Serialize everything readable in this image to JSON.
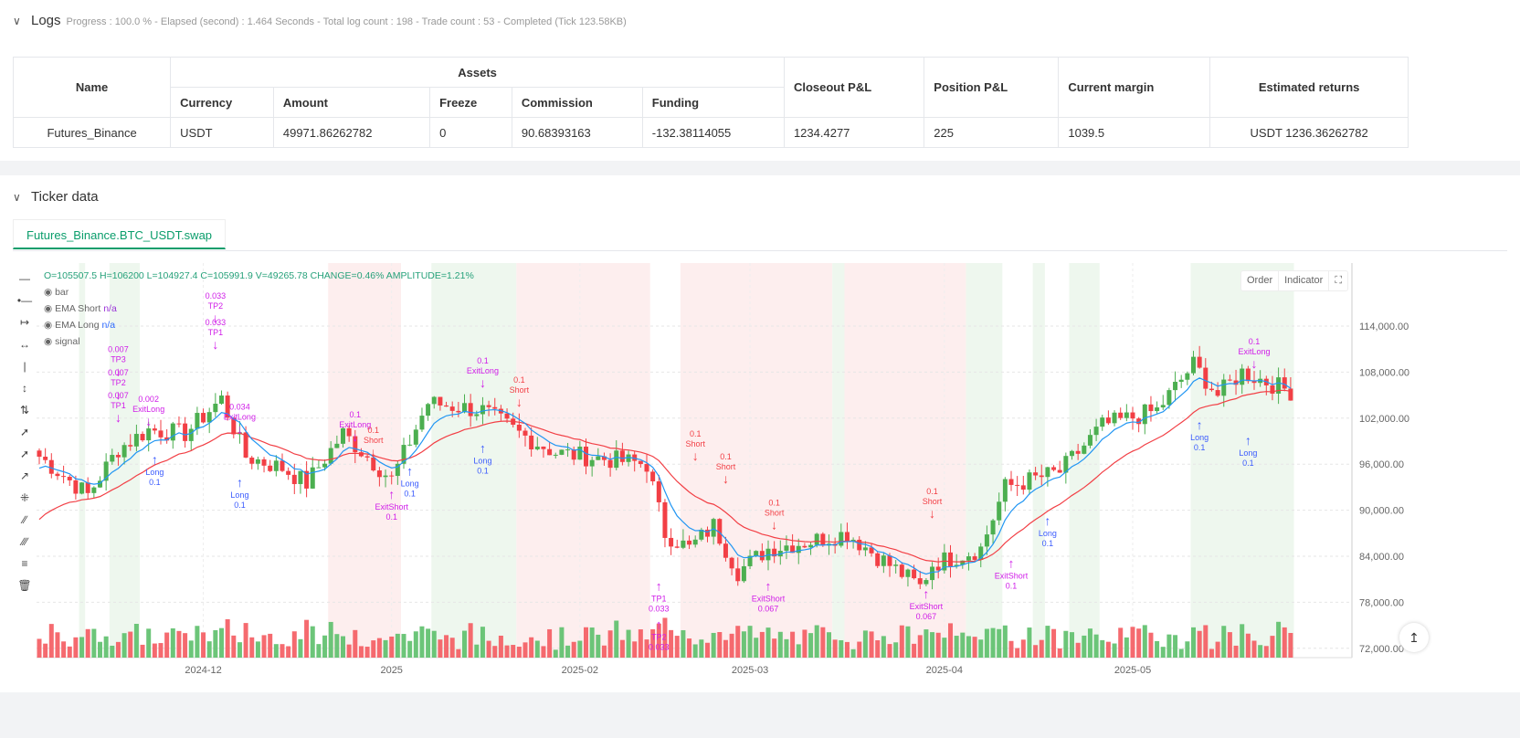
{
  "logs": {
    "title": "Logs",
    "summary": "Progress : 100.0 % - Elapsed (second) : 1.464  Seconds - Total log count : 198 - Trade count : 53 - Completed (Tick 123.58KB)"
  },
  "table": {
    "group_headers": {
      "name": "Name",
      "assets": "Assets",
      "closeout": "Closeout P&L",
      "position": "Position P&L",
      "margin": "Current margin",
      "returns": "Estimated returns"
    },
    "sub_headers": [
      "Currency",
      "Amount",
      "Freeze",
      "Commission",
      "Funding"
    ],
    "row": {
      "name": "Futures_Binance",
      "currency": "USDT",
      "amount": "49971.86262782",
      "freeze": "0",
      "commission": "90.68393163",
      "funding": "-132.38114055",
      "closeout": "1234.4277",
      "position": "225",
      "margin": "1039.5",
      "returns": "USDT 1236.36262782"
    }
  },
  "ticker": {
    "title": "Ticker data",
    "tab": "Futures_Binance.BTC_USDT.swap"
  },
  "chart_buttons": {
    "order": "Order",
    "indicator": "Indicator"
  },
  "legend": {
    "ohlc": "O=105507.5 H=106200 L=104927.4 C=105991.9 V=49265.78 CHANGE=0.46% AMPLITUDE=1.21%",
    "items": [
      "bar",
      "EMA Short",
      "EMA Long",
      "signal"
    ],
    "na": "n/a"
  },
  "colors": {
    "up": "#4caf50",
    "down": "#f23f45",
    "ema_short": "#2196f3",
    "ema_long": "#f23f45",
    "green_bg": "#eef7ee",
    "red_bg": "#fdeeee",
    "signal": "#d01ee8",
    "long": "#3b5bfd"
  },
  "chart_data": {
    "type": "candlestick",
    "ylim": [
      70000,
      117000
    ],
    "y_ticks": [
      72000,
      78000,
      84000,
      90000,
      96000,
      102000,
      108000,
      114000
    ],
    "y_tick_labels": [
      "72,000.00",
      "78,000.00",
      "84,000.00",
      "90,000.00",
      "96,000.00",
      "102,000.00",
      "108,000.00",
      "114,000.00"
    ],
    "x_ticks": [
      {
        "day": 27,
        "label": "2024-12"
      },
      {
        "day": 58,
        "label": "2025"
      },
      {
        "day": 89,
        "label": "2025-02"
      },
      {
        "day": 117,
        "label": "2025-03"
      },
      {
        "day": 149,
        "label": "2025-04"
      },
      {
        "day": 180,
        "label": "2025-05"
      }
    ],
    "days": 207,
    "price_path": [
      [
        0,
        97000
      ],
      [
        8,
        92000
      ],
      [
        13,
        98000
      ],
      [
        18,
        100500
      ],
      [
        24,
        100000
      ],
      [
        30,
        104500
      ],
      [
        34,
        97000
      ],
      [
        40,
        95500
      ],
      [
        44,
        93500
      ],
      [
        50,
        100000
      ],
      [
        58,
        94000
      ],
      [
        64,
        104000
      ],
      [
        73,
        103000
      ],
      [
        79,
        100000
      ],
      [
        85,
        97500
      ],
      [
        100,
        96000
      ],
      [
        103,
        87000
      ],
      [
        107,
        85000
      ],
      [
        111,
        88000
      ],
      [
        115,
        82000
      ],
      [
        120,
        85000
      ],
      [
        127,
        86000
      ],
      [
        133,
        87000
      ],
      [
        138,
        84000
      ],
      [
        145,
        80000
      ],
      [
        147,
        83000
      ],
      [
        155,
        85000
      ],
      [
        159,
        93000
      ],
      [
        168,
        95000
      ],
      [
        175,
        101000
      ],
      [
        184,
        103000
      ],
      [
        190,
        109000
      ],
      [
        194,
        105000
      ],
      [
        198,
        108000
      ],
      [
        206,
        105500
      ]
    ],
    "regimes": [
      {
        "from": 7,
        "to": 8,
        "side": "long"
      },
      {
        "from": 12,
        "to": 17,
        "side": "long"
      },
      {
        "from": 48,
        "to": 60,
        "side": "short"
      },
      {
        "from": 65,
        "to": 79,
        "side": "long"
      },
      {
        "from": 79,
        "to": 101,
        "side": "short"
      },
      {
        "from": 106,
        "to": 131,
        "side": "short"
      },
      {
        "from": 131,
        "to": 133,
        "side": "long"
      },
      {
        "from": 133,
        "to": 153,
        "side": "short"
      },
      {
        "from": 153,
        "to": 159,
        "side": "long"
      },
      {
        "from": 164,
        "to": 166,
        "side": "long"
      },
      {
        "from": 170,
        "to": 175,
        "side": "long"
      },
      {
        "from": 190,
        "to": 207,
        "side": "long"
      }
    ],
    "signals": [
      {
        "day": 13,
        "price": 101500,
        "dir": "down",
        "text": [
          "0.007",
          "TP1"
        ]
      },
      {
        "day": 13,
        "price": 104500,
        "dir": "down",
        "text": [
          "0.007",
          "TP2"
        ]
      },
      {
        "day": 13,
        "price": 107500,
        "dir": "down",
        "text": [
          "0.007",
          "TP3"
        ]
      },
      {
        "day": 18,
        "price": 101000,
        "dir": "down",
        "text": [
          "0.002",
          "ExitLong"
        ]
      },
      {
        "day": 29,
        "price": 111000,
        "dir": "down",
        "text": [
          "0.033",
          "TP1"
        ]
      },
      {
        "day": 29,
        "price": 114500,
        "dir": "down",
        "text": [
          "0.033",
          "TP2"
        ]
      },
      {
        "day": 33,
        "price": 100000,
        "dir": "down",
        "text": [
          "0.034",
          "ExitLong"
        ]
      },
      {
        "day": 19,
        "price": 96500,
        "dir": "uplong",
        "text": [
          "Long",
          "0.1"
        ]
      },
      {
        "day": 33,
        "price": 93500,
        "dir": "uplong",
        "text": [
          "Long",
          "0.1"
        ]
      },
      {
        "day": 52,
        "price": 99000,
        "dir": "down",
        "text": [
          "0.1",
          "ExitLong"
        ]
      },
      {
        "day": 55,
        "price": 97000,
        "dir": "downshort",
        "text": [
          "0.1",
          "Short"
        ]
      },
      {
        "day": 58,
        "price": 92000,
        "dir": "up",
        "text": [
          "ExitShort",
          "0.1"
        ]
      },
      {
        "day": 61,
        "price": 95000,
        "dir": "uplong",
        "text": [
          "Long",
          "0.1"
        ]
      },
      {
        "day": 73,
        "price": 98000,
        "dir": "uplong",
        "text": [
          "Long",
          "0.1"
        ]
      },
      {
        "day": 73,
        "price": 106000,
        "dir": "down",
        "text": [
          "0.1",
          "ExitLong"
        ]
      },
      {
        "day": 79,
        "price": 103500,
        "dir": "downshort",
        "text": [
          "0.1",
          "Short"
        ]
      },
      {
        "day": 108,
        "price": 96500,
        "dir": "downshort",
        "text": [
          "0.1",
          "Short"
        ]
      },
      {
        "day": 113,
        "price": 93500,
        "dir": "downshort",
        "text": [
          "0.1",
          "Short"
        ]
      },
      {
        "day": 102,
        "price": 80000,
        "dir": "up",
        "text": [
          "TP1",
          "0.033"
        ]
      },
      {
        "day": 102,
        "price": 75000,
        "dir": "up",
        "text": [
          "TP2",
          "0.033"
        ]
      },
      {
        "day": 120,
        "price": 80000,
        "dir": "up",
        "text": [
          "ExitShort",
          "0.067"
        ]
      },
      {
        "day": 121,
        "price": 87500,
        "dir": "downshort",
        "text": [
          "0.1",
          "Short"
        ]
      },
      {
        "day": 147,
        "price": 89000,
        "dir": "downshort",
        "text": [
          "0.1",
          "Short"
        ]
      },
      {
        "day": 146,
        "price": 79000,
        "dir": "up",
        "text": [
          "ExitShort",
          "0.067"
        ]
      },
      {
        "day": 160,
        "price": 83000,
        "dir": "up",
        "text": [
          "ExitShort",
          "0.1"
        ]
      },
      {
        "day": 166,
        "price": 88500,
        "dir": "uplong",
        "text": [
          "Long",
          "0.1"
        ]
      },
      {
        "day": 191,
        "price": 101000,
        "dir": "uplong",
        "text": [
          "Long",
          "0.1"
        ]
      },
      {
        "day": 200,
        "price": 108500,
        "dir": "down",
        "text": [
          "0.1",
          "ExitLong"
        ]
      },
      {
        "day": 199,
        "price": 99000,
        "dir": "uplong",
        "text": [
          "Long",
          "0.1"
        ]
      }
    ]
  }
}
